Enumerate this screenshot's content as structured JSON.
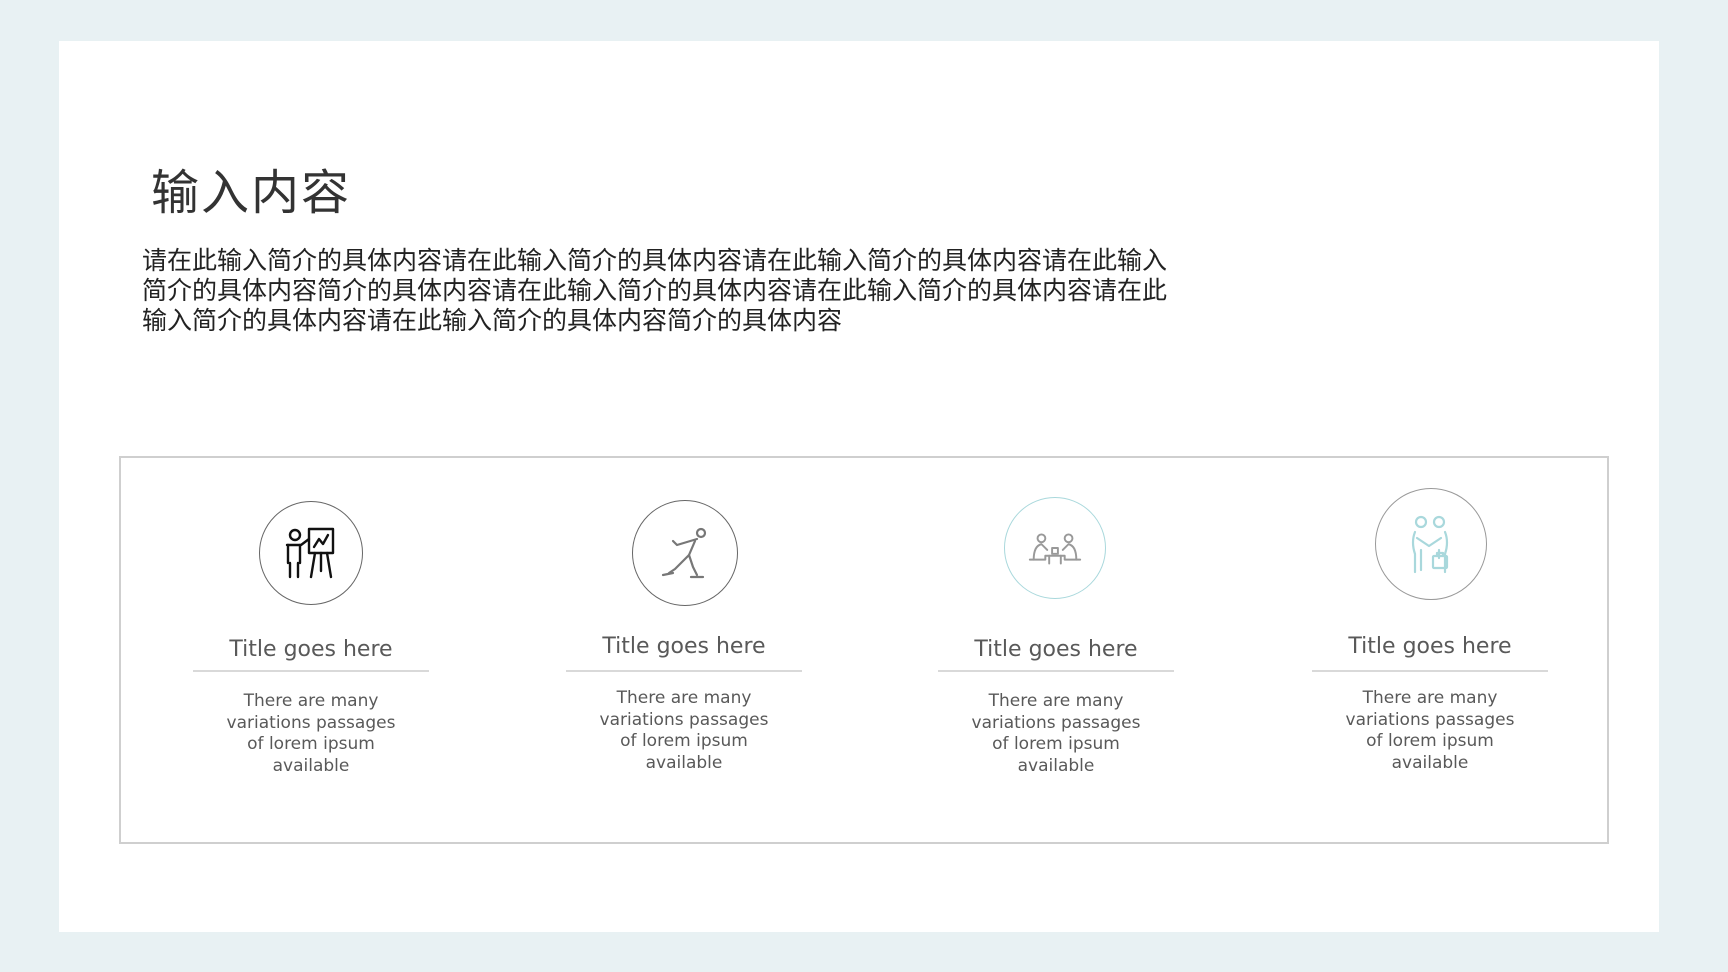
{
  "slide": {
    "title": "输入内容",
    "intro_lines": [
      "请在此输入简介的具体内容请在此输入简介的具体内容请在此输入简介的具体内容请在此输入",
      "简介的具体内容简介的具体内容请在此输入简介的具体内容请在此输入简介的具体内容请在此",
      "输入简介的具体内容请在此输入简介的具体内容简介的具体内容"
    ]
  },
  "cards": [
    {
      "icon": "presenter-easel-icon",
      "title": "Title goes here",
      "desc": "There are many variations passages of lorem ipsum available"
    },
    {
      "icon": "ice-skater-icon",
      "title": "Title goes here",
      "desc": "There are many variations passages of lorem ipsum available"
    },
    {
      "icon": "meeting-table-icon",
      "title": "Title goes here",
      "desc": "There are many variations passages of lorem ipsum available"
    },
    {
      "icon": "handshake-briefcase-icon",
      "title": "Title goes here",
      "desc": "There are many variations passages of lorem ipsum available"
    }
  ],
  "colors": {
    "background": "#e8f1f3",
    "slide": "#ffffff",
    "panel_border": "#cfcfcf",
    "text": "#595959",
    "accent_teal": "#a9d8dc",
    "icon_dark": "#222222"
  }
}
